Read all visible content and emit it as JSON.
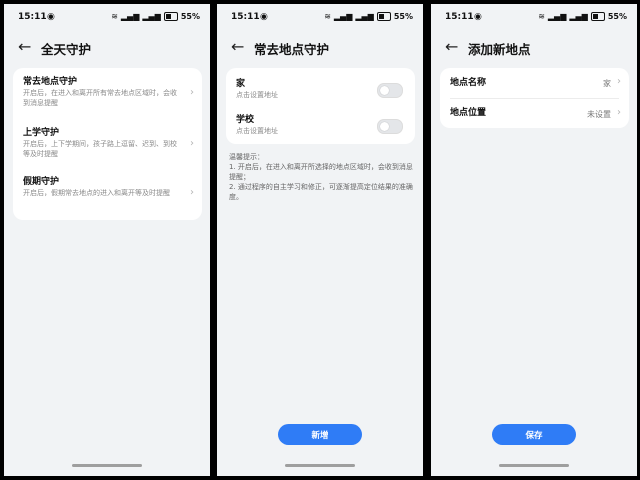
{
  "status": {
    "time": "15:11",
    "battery": "55%"
  },
  "screens": [
    {
      "title": "全天守护",
      "items": [
        {
          "title": "常去地点守护",
          "desc": "开启后，在进入和离开所有常去地点区域时，会收到消息提醒"
        },
        {
          "title": "上学守护",
          "desc": "开启后，上下学期间，孩子路上逗留、迟到、到校等及时提醒"
        },
        {
          "title": "假期守护",
          "desc": "开启后，假期常去地点的进入和离开等及时提醒"
        }
      ]
    },
    {
      "title": "常去地点守护",
      "items": [
        {
          "title": "家",
          "desc": "点击设置地址",
          "enabled": false
        },
        {
          "title": "学校",
          "desc": "点击设置地址",
          "enabled": false
        }
      ],
      "tips": [
        "温馨提示：",
        "1. 开启后，在进入和离开所选择的地点区域时，会收到消息提醒；",
        "2. 通过程序的自主学习和修正，可逐渐提高定位结果的准确度。"
      ],
      "button": "新增"
    },
    {
      "title": "添加新地点",
      "fields": [
        {
          "label": "地点名称",
          "value": "家"
        },
        {
          "label": "地点位置",
          "value": "未设置"
        }
      ],
      "button": "保存"
    }
  ],
  "colors": {
    "accent": "#2f7cf6",
    "background": "#f1f3f5"
  }
}
